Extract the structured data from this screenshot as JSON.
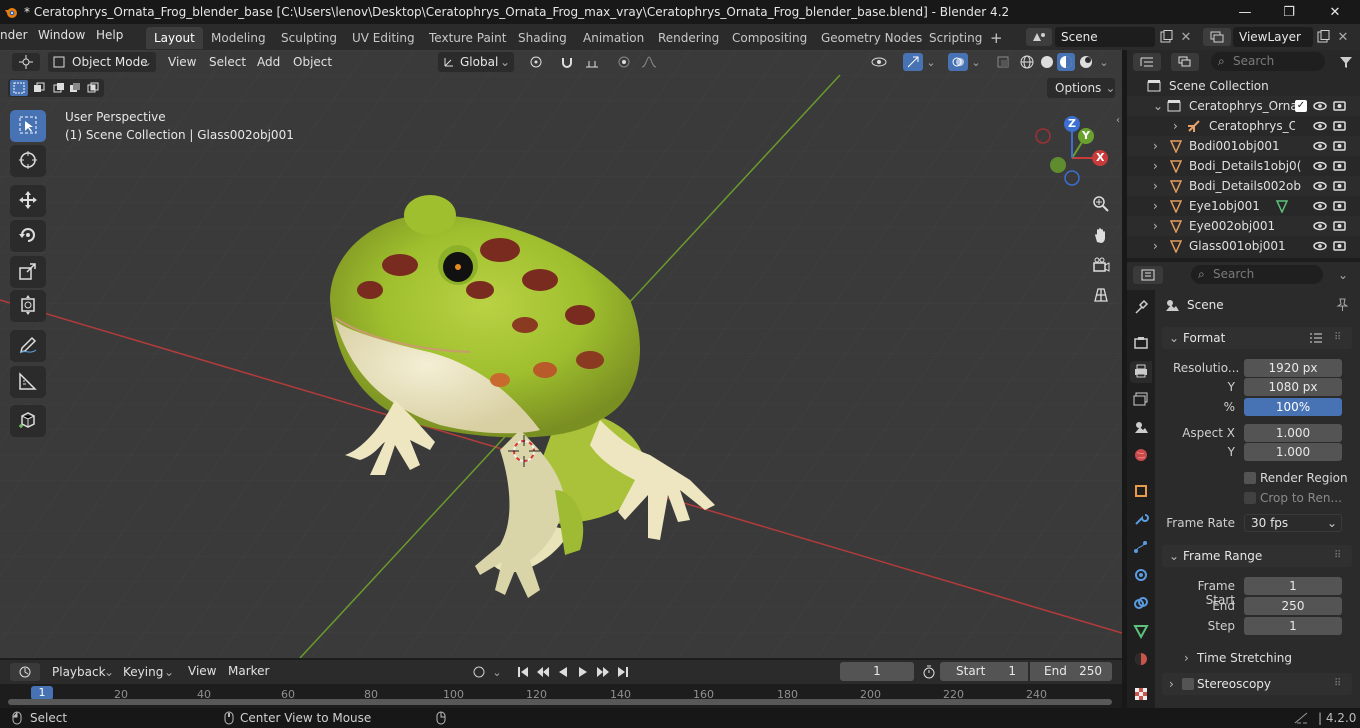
{
  "window": {
    "title": "* Ceratophrys_Ornata_Frog_blender_base [C:\\Users\\lenov\\Desktop\\Ceratophrys_Ornata_Frog_max_vray\\Ceratophrys_Ornata_Frog_blender_base.blend] - Blender 4.2",
    "minimize": "—",
    "maximize": "❐",
    "close": "✕"
  },
  "menu": {
    "render": "nder",
    "window": "Window",
    "help": "Help"
  },
  "workspaces": [
    "Layout",
    "Modeling",
    "Sculpting",
    "UV Editing",
    "Texture Paint",
    "Shading",
    "Animation",
    "Rendering",
    "Compositing",
    "Geometry Nodes",
    "Scripting"
  ],
  "workspace_add": "+",
  "scene": {
    "name": "Scene",
    "view_layer": "ViewLayer"
  },
  "viewport": {
    "mode": "Object Mode",
    "menus": {
      "view": "View",
      "select": "Select",
      "add": "Add",
      "object": "Object"
    },
    "transform_orientation": "Global",
    "options": "Options",
    "perspective": "User Perspective",
    "collection_info": "(1) Scene Collection | Glass002obj001",
    "gizmo": {
      "x": "X",
      "y": "Y",
      "z": "Z"
    }
  },
  "outliner": {
    "search_placeholder": "Search",
    "root": "Scene Collection",
    "items": [
      {
        "label": "Ceratophrys_Ornat"
      },
      {
        "label": "Ceratophrys_Or"
      },
      {
        "label": "Bodi001obj001"
      },
      {
        "label": "Bodi_Details1obj0("
      },
      {
        "label": "Bodi_Details002ob"
      },
      {
        "label": "Eye1obj001"
      },
      {
        "label": "Eye002obj001"
      },
      {
        "label": "Glass001obj001"
      }
    ]
  },
  "properties": {
    "search_placeholder": "Search",
    "context": "Scene",
    "format": {
      "title": "Format",
      "resolution_label": "Resolutio...",
      "res_x": "1920 px",
      "y_label": "Y",
      "res_y": "1080 px",
      "pct_label": "%",
      "pct": "100%",
      "aspect_label": "Aspect X",
      "aspect_x": "1.000",
      "aspect_y_label": "Y",
      "aspect_y": "1.000",
      "render_region": "Render Region",
      "crop": "Crop to Ren...",
      "frame_rate_label": "Frame Rate",
      "frame_rate": "30 fps"
    },
    "frame_range": {
      "title": "Frame Range",
      "start_label": "Frame Start",
      "start": "1",
      "end_label": "End",
      "end": "250",
      "step_label": "Step",
      "step": "1"
    },
    "time_stretching": "Time Stretching",
    "stereoscopy": "Stereoscopy"
  },
  "timeline": {
    "playback": "Playback",
    "keying": "Keying",
    "view": "View",
    "marker": "Marker",
    "current_frame": "1",
    "start_label": "Start",
    "start": "1",
    "end_label": "End",
    "end": "250",
    "ruler": [
      "1",
      "20",
      "40",
      "60",
      "80",
      "100",
      "120",
      "140",
      "160",
      "180",
      "200",
      "220",
      "240"
    ]
  },
  "status": {
    "select": "Select",
    "center": "Center View to Mouse",
    "version": "4.2.0"
  },
  "colors": {
    "accent": "#4772b3",
    "x_axis": "#c93a3a",
    "y_axis": "#6aa12e",
    "z_axis": "#3b6fd1"
  }
}
